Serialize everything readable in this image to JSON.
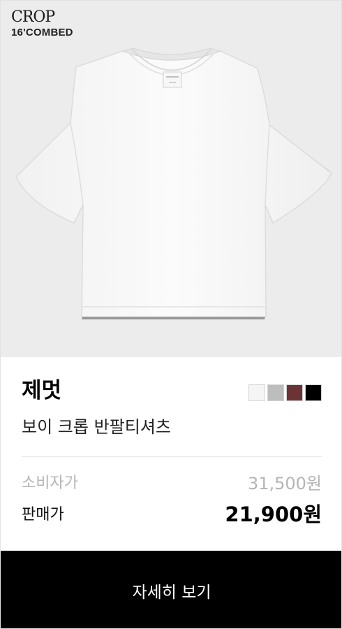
{
  "image": {
    "brand_logo": "CROP",
    "brand_subtitle": "16'COMBED",
    "product_image_icon": "white-tshirt-image"
  },
  "product": {
    "brand": "제멋",
    "name": "보이 크롭 반팔티셔츠",
    "color_options": [
      "#f5f5f5",
      "#bdbdbd",
      "#6b3333",
      "#000000"
    ]
  },
  "pricing": {
    "retail_label": "소비자가",
    "retail_value": "31,500원",
    "sale_label": "판매가",
    "sale_value": "21,900원"
  },
  "cta": {
    "label": "자세히 보기"
  }
}
